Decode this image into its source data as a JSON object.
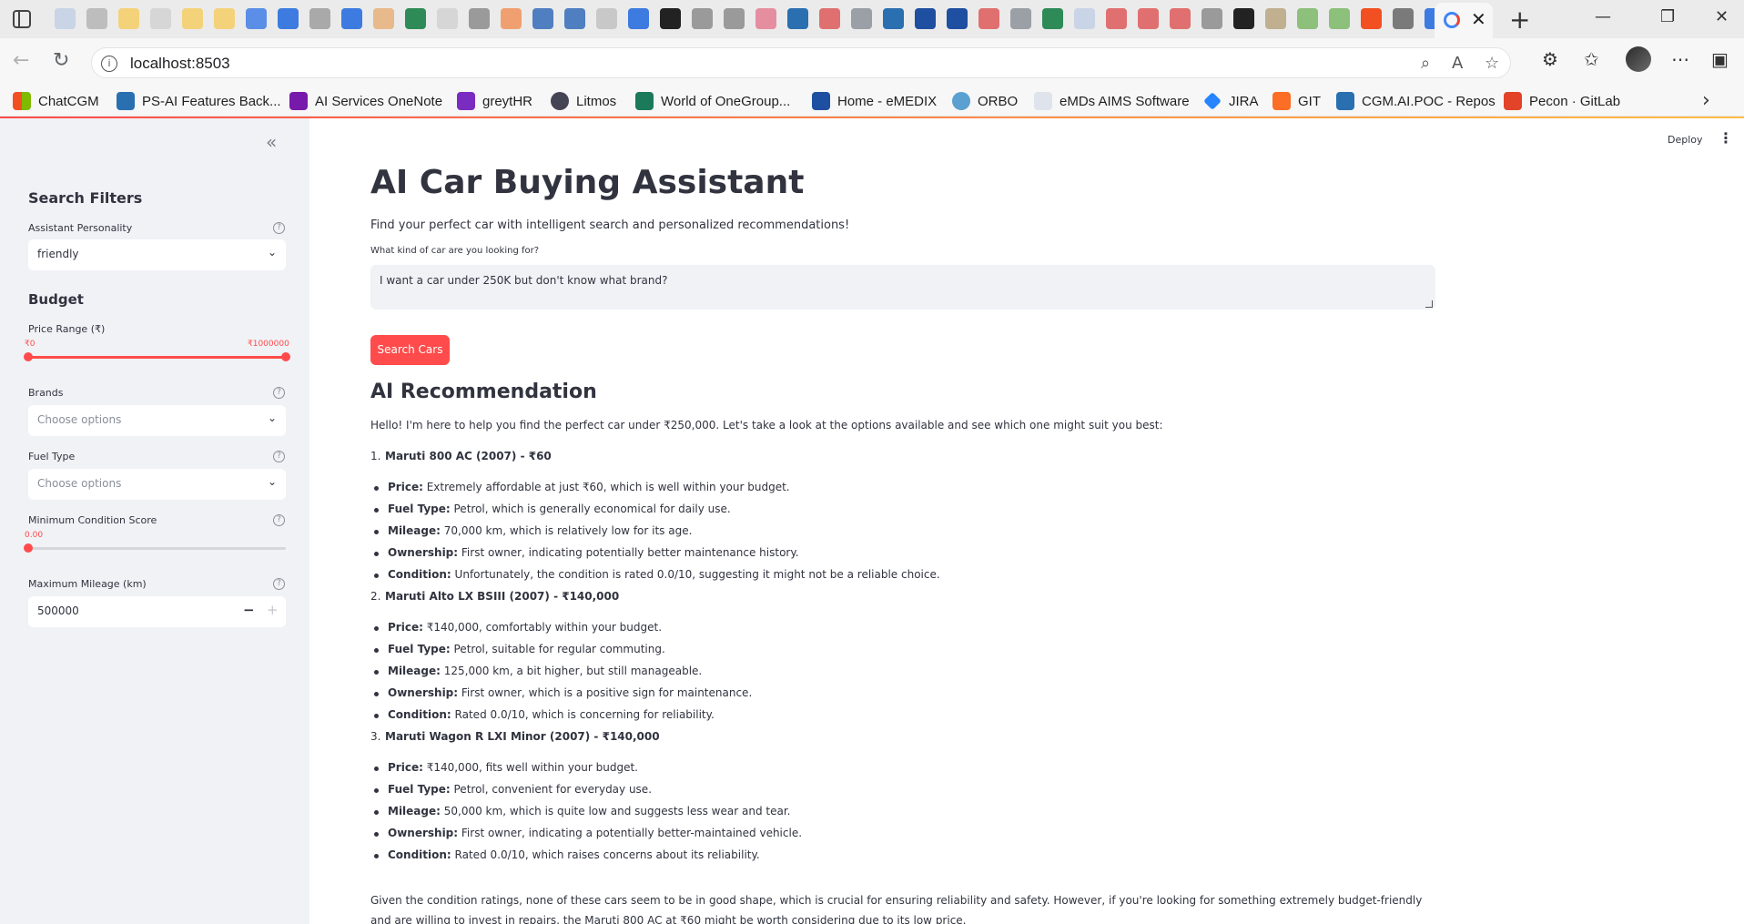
{
  "browser": {
    "url": "localhost:8503",
    "bookmarks": [
      "ChatCGM",
      "PS-AI Features Back...",
      "AI Services OneNote",
      "greytHR",
      "Litmos",
      "World of OneGroup...",
      "Home - eMEDIX",
      "ORBO",
      "eMDs AIMS Software",
      "JIRA",
      "GIT",
      "CGM.AI.POC - Repos",
      "Pecon · GitLab"
    ]
  },
  "app": {
    "deploy_label": "Deploy",
    "title": "AI Car Buying Assistant",
    "subtitle": "Find your perfect car with intelligent search and personalized recommendations!",
    "query_label": "What kind of car are you looking for?",
    "query_value": "I want a car under 250K but don't know what brand?",
    "search_button": "Search Cars",
    "accent_color": "#ff4b4b"
  },
  "sidebar": {
    "heading": "Search Filters",
    "personality_label": "Assistant Personality",
    "personality_value": "friendly",
    "budget_heading": "Budget",
    "price_label": "Price Range (₹)",
    "price_min": "₹0",
    "price_max": "₹1000000",
    "brands_label": "Brands",
    "brands_placeholder": "Choose options",
    "fuel_label": "Fuel Type",
    "fuel_placeholder": "Choose options",
    "condition_label": "Minimum Condition Score",
    "condition_value": "0.00",
    "mileage_label": "Maximum Mileage (km)",
    "mileage_value": "500000"
  },
  "recommendation": {
    "heading": "AI Recommendation",
    "intro": "Hello! I'm here to help you find the perfect car under ₹250,000. Let's take a look at the options available and see which one might suit you best:",
    "cars": [
      {
        "title": "Maruti 800 AC (2007) - ₹60",
        "points": [
          {
            "label": "Price:",
            "text": " Extremely affordable at just ₹60, which is well within your budget."
          },
          {
            "label": "Fuel Type:",
            "text": " Petrol, which is generally economical for daily use."
          },
          {
            "label": "Mileage:",
            "text": " 70,000 km, which is relatively low for its age."
          },
          {
            "label": "Ownership:",
            "text": " First owner, indicating potentially better maintenance history."
          },
          {
            "label": "Condition:",
            "text": " Unfortunately, the condition is rated 0.0/10, suggesting it might not be a reliable choice."
          }
        ]
      },
      {
        "title": "Maruti Alto LX BSIII (2007) - ₹140,000",
        "points": [
          {
            "label": "Price:",
            "text": " ₹140,000, comfortably within your budget."
          },
          {
            "label": "Fuel Type:",
            "text": " Petrol, suitable for regular commuting."
          },
          {
            "label": "Mileage:",
            "text": " 125,000 km, a bit higher, but still manageable."
          },
          {
            "label": "Ownership:",
            "text": " First owner, which is a positive sign for maintenance."
          },
          {
            "label": "Condition:",
            "text": " Rated 0.0/10, which is concerning for reliability."
          }
        ]
      },
      {
        "title": "Maruti Wagon R LXI Minor (2007) - ₹140,000",
        "points": [
          {
            "label": "Price:",
            "text": " ₹140,000, fits well within your budget."
          },
          {
            "label": "Fuel Type:",
            "text": " Petrol, convenient for everyday use."
          },
          {
            "label": "Mileage:",
            "text": " 50,000 km, which is quite low and suggests less wear and tear."
          },
          {
            "label": "Ownership:",
            "text": " First owner, indicating a potentially better-maintained vehicle."
          },
          {
            "label": "Condition:",
            "text": " Rated 0.0/10, which raises concerns about its reliability."
          }
        ]
      }
    ],
    "conclusion": "Given the condition ratings, none of these cars seem to be in good shape, which is crucial for ensuring reliability and safety. However, if you're looking for something extremely budget-friendly and are willing to invest in repairs, the Maruti 800 AC at ₹60 might be worth considering due to its low price."
  }
}
